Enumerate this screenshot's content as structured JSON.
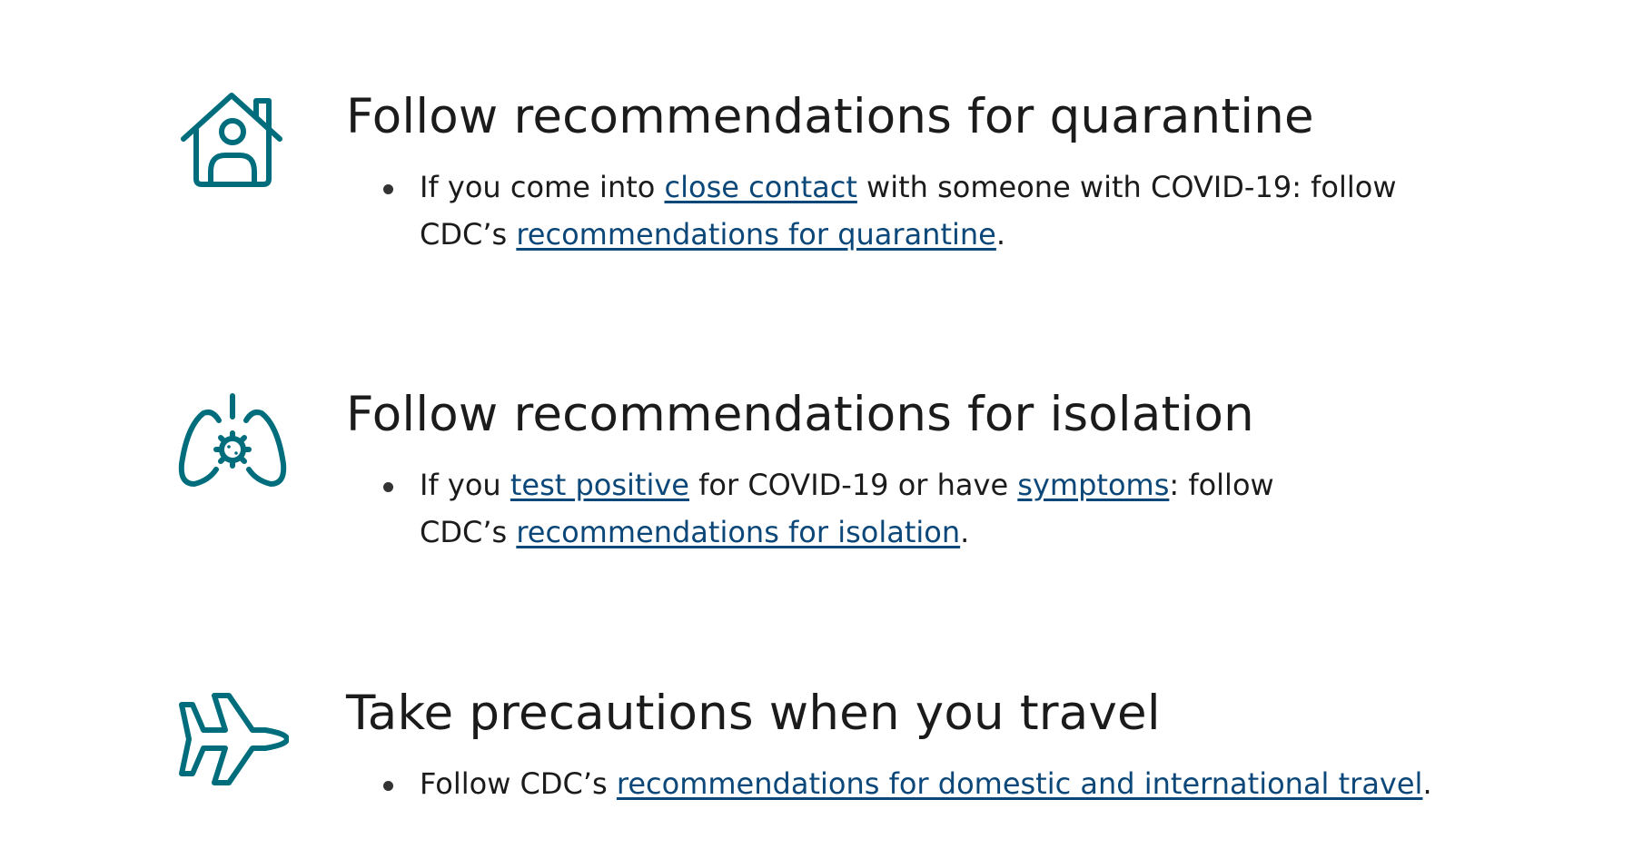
{
  "colors": {
    "icon": "#006d7d",
    "link": "#0b4778",
    "text": "#1b1b1b"
  },
  "sections": [
    {
      "icon": "house-person-icon",
      "heading": "Follow recommendations for quarantine",
      "bullet": {
        "t1": "If you come into ",
        "l1": "close contact",
        "t2": " with someone with COVID-19: follow",
        "t3": "CDC’s ",
        "l2": "recommendations for quarantine",
        "t4": "."
      }
    },
    {
      "icon": "lungs-virus-icon",
      "heading": "Follow recommendations for isolation",
      "bullet": {
        "t1": "If you ",
        "l1": "test positive",
        "t2": " for COVID-19 or have ",
        "l2": "symptoms",
        "t3": ": follow",
        "t4": "CDC’s ",
        "l3": "recommendations for isolation",
        "t5": "."
      }
    },
    {
      "icon": "airplane-icon",
      "heading": "Take precautions when you travel",
      "bullet": {
        "t1": "Follow CDC’s ",
        "l1": "recommendations for domestic and international travel",
        "t2": "."
      }
    }
  ]
}
